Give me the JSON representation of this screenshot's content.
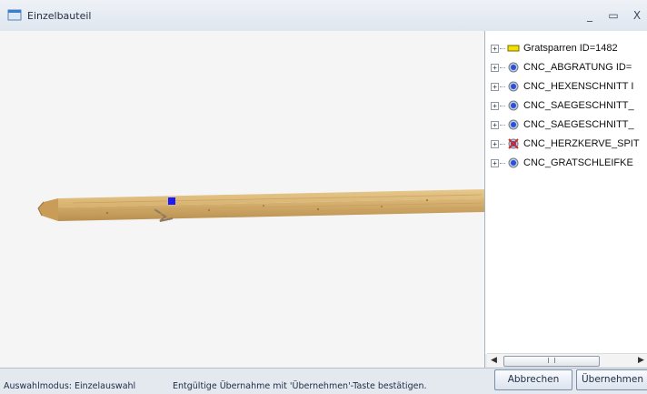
{
  "window": {
    "title": "Einzelbauteil",
    "minimize_label": "_",
    "maximize_label": "▭",
    "close_label": "X"
  },
  "tree": {
    "items": [
      {
        "label": "Gratsparren ID=1482",
        "icon": "yellow-beam-icon",
        "expander": "+"
      },
      {
        "label": "CNC_ABGRATUNG ID=",
        "icon": "gear-blue-icon",
        "expander": "+"
      },
      {
        "label": "CNC_HEXENSCHNITT I",
        "icon": "gear-blue-icon",
        "expander": "+"
      },
      {
        "label": "CNC_SAEGESCHNITT_",
        "icon": "gear-blue-icon",
        "expander": "+"
      },
      {
        "label": "CNC_SAEGESCHNITT_",
        "icon": "gear-blue-icon",
        "expander": "+"
      },
      {
        "label": "CNC_HERZKERVE_SPIT",
        "icon": "gear-red-icon",
        "expander": "+"
      },
      {
        "label": "CNC_GRATSCHLEIFKE",
        "icon": "gear-blue-icon",
        "expander": "+"
      }
    ]
  },
  "scrollbar": {
    "left_arrow": "◀",
    "right_arrow": "▶"
  },
  "status": {
    "mode": "Auswahlmodus: Einzelauswahl",
    "hint": "Entgültige Übernahme mit 'Übernehmen'-Taste bestätigen."
  },
  "buttons": {
    "cancel": "Abbrechen",
    "apply": "Übernehmen"
  },
  "colors": {
    "beam": "#d9b373",
    "selection_marker": "#1a1aff",
    "gear_blue": "#2b4fd6",
    "gear_red": "#d42a2a",
    "beam_icon_yellow": "#f2e000"
  }
}
